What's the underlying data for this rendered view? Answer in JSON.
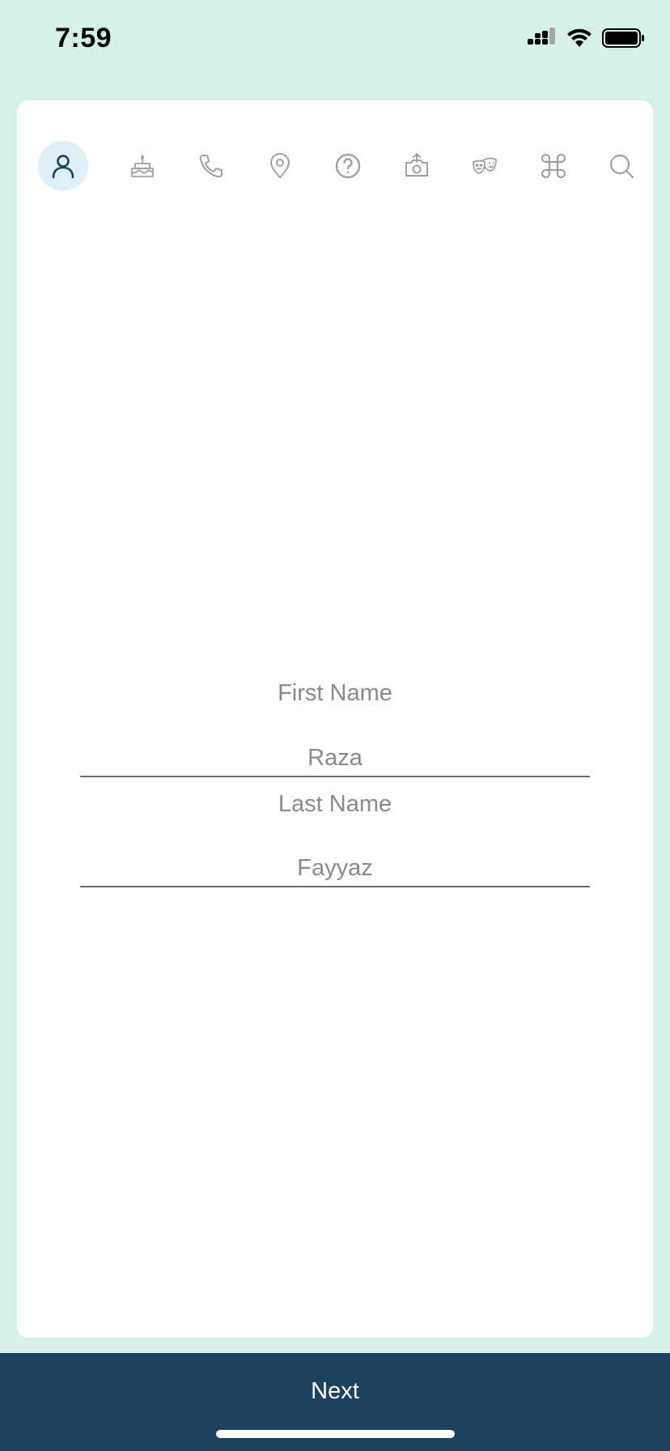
{
  "status_bar": {
    "time": "7:59",
    "icons": [
      "cellular-signal-icon",
      "wifi-icon",
      "battery-icon"
    ]
  },
  "step_icons": [
    {
      "name": "person-icon",
      "active": true
    },
    {
      "name": "birthday-cake-icon",
      "active": false
    },
    {
      "name": "phone-icon",
      "active": false
    },
    {
      "name": "location-pin-icon",
      "active": false
    },
    {
      "name": "question-circle-icon",
      "active": false
    },
    {
      "name": "camera-upload-icon",
      "active": false
    },
    {
      "name": "theater-masks-icon",
      "active": false
    },
    {
      "name": "command-key-icon",
      "active": false
    },
    {
      "name": "search-icon",
      "active": false
    }
  ],
  "form": {
    "first_name_label": "First Name",
    "first_name_value": "Raza",
    "last_name_label": "Last Name",
    "last_name_value": "Fayyaz"
  },
  "footer": {
    "next_label": "Next"
  },
  "colors": {
    "background": "#d6f0ea",
    "card": "#ffffff",
    "active_icon_bg": "#ddf0f8",
    "active_icon": "#1d425e",
    "inactive_icon": "#a0a0a0",
    "footer": "#1d425e"
  }
}
